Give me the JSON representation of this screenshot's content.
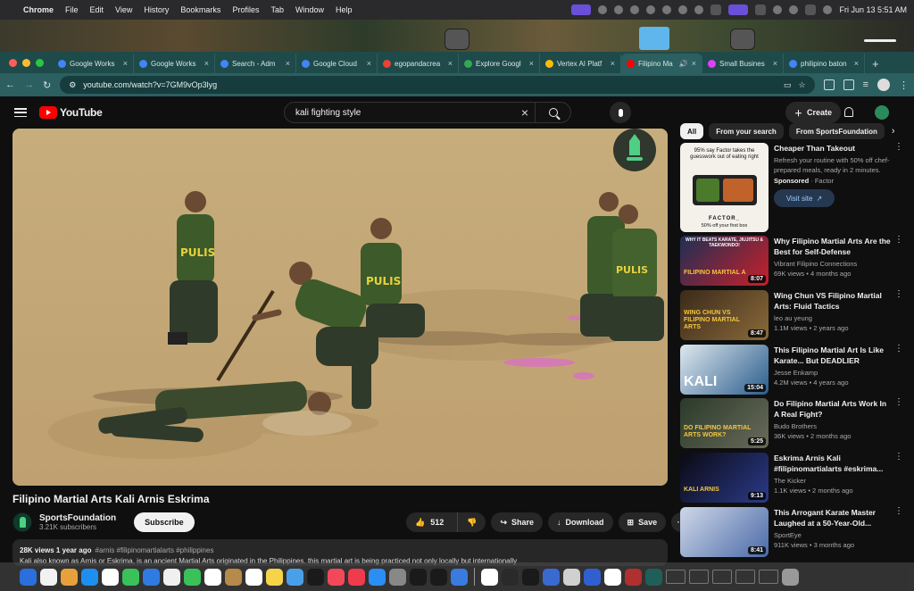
{
  "menubar": {
    "app_name": "Chrome",
    "menus": [
      "File",
      "Edit",
      "View",
      "History",
      "Bookmarks",
      "Profiles",
      "Tab",
      "Window",
      "Help"
    ],
    "datetime": "Fri Jun 13  5:51 AM"
  },
  "browser": {
    "tabs": [
      {
        "label": "Google Works",
        "color": "#4285f4"
      },
      {
        "label": "Google Works",
        "color": "#4285f4"
      },
      {
        "label": "Search - Adm",
        "color": "#4285f4"
      },
      {
        "label": "Google Cloud",
        "color": "#4285f4"
      },
      {
        "label": "egopandacrea",
        "color": "#ea4335"
      },
      {
        "label": "Explore Googl",
        "color": "#34a853"
      },
      {
        "label": "Vertex AI Platf",
        "color": "#fbbc04"
      },
      {
        "label": "Filipino Ma",
        "color": "#ff0000",
        "active": true
      },
      {
        "label": "Small Busines",
        "color": "#e040fb"
      },
      {
        "label": "philipino baton",
        "color": "#4285f4"
      }
    ],
    "url": "youtube.com/watch?v=7GM9vOp3lyg"
  },
  "youtube": {
    "logo_text": "YouTube",
    "search_query": "kali fighting style",
    "create_label": "Create"
  },
  "video": {
    "title": "Filipino Martial Arts Kali Arnis Eskrima",
    "channel": "SportsFoundation",
    "subscribers": "3.21K subscribers",
    "subscribe_label": "Subscribe",
    "likes": "512",
    "share_label": "Share",
    "download_label": "Download",
    "save_label": "Save",
    "views_date": "28K views  1 year ago",
    "hashtags": "#arnis #filipinomartialarts #philippines",
    "description": "Kali also known as Arnis or Eskrima, is an ancient Martial Arts originated in the Philippines. this martial art is being practiced not only locally but internationally",
    "shirt_text": "PULIS"
  },
  "chips": [
    "All",
    "From your search",
    "From SportsFoundation"
  ],
  "ad": {
    "title": "Cheaper Than Takeout",
    "desc": "Refresh your routine with 50% off chef-prepared meals, ready in 2 minutes.",
    "sponsored": "Sponsored",
    "advertiser": "Factor",
    "visit_label": "Visit site",
    "img_headline": "95% say Factor takes the guesswork out of eating right",
    "img_brand": "FACTOR_",
    "img_offer": "50% off your first box"
  },
  "recommendations": [
    {
      "title": "Why Filipino Martial Arts Are the Best for Self-Defense",
      "channel": "Vibrant Filipino Connections",
      "meta": "69K views • 4 months ago",
      "duration": "8:07",
      "thumb_text": "FILIPINO MARTIAL A",
      "thumb_top": "WHY IT BEATS KARATE, JIUJITSU & TAEKWONDO!",
      "colors": [
        "#1d2f55",
        "#c8202a"
      ]
    },
    {
      "title": "Wing Chun VS Filipino Martial Arts: Fluid Tactics",
      "channel": "leo au yeung",
      "meta": "1.1M views • 2 years ago",
      "duration": "8:47",
      "thumb_text": "WING CHUN VS FILIPINO MARTIAL ARTS",
      "thumb_top": "",
      "colors": [
        "#3a2a1a",
        "#8a6a3a"
      ]
    },
    {
      "title": "This Filipino Martial Art Is Like Karate... But DEADLIER",
      "channel": "Jesse Enkamp",
      "meta": "4.2M views • 4 years ago",
      "duration": "15:04",
      "thumb_text": "KALI",
      "thumb_top": "",
      "colors": [
        "#dfe8ef",
        "#2a5d8c"
      ]
    },
    {
      "title": "Do Filipino Martial Arts Work In A Real Fight?",
      "channel": "Budo Brothers",
      "meta": "36K views • 2 months ago",
      "duration": "5:25",
      "thumb_text": "DO FILIPINO MARTIAL ARTS WORK?",
      "thumb_top": "",
      "colors": [
        "#2a3a2a",
        "#6a6a5a"
      ]
    },
    {
      "title": "Eskrima Arnis Kali #filipinomartialarts #eskrima...",
      "channel": "The Kicker",
      "meta": "1.1K views • 2 months ago",
      "duration": "9:13",
      "thumb_text": "KALI ARNIS",
      "thumb_top": "",
      "colors": [
        "#0a0a12",
        "#2b3a8a"
      ]
    },
    {
      "title": "This Arrogant Karate Master Laughed at a 50-Year-Old...",
      "channel": "SportEye",
      "meta": "911K views • 3 months ago",
      "duration": "8:41",
      "thumb_text": "",
      "thumb_top": "",
      "colors": [
        "#cfd8e8",
        "#4a6aa8"
      ]
    }
  ],
  "dock": {
    "apps": [
      "#2a6fdb",
      "#f2f2f2",
      "#e8a13a",
      "#1f8ef1",
      "#ffffff",
      "#3ac15a",
      "#2f7be0",
      "#f0f0f0",
      "#3ac15a",
      "#ffffff",
      "#b58a4a",
      "#ffffff",
      "#f5d44a",
      "#4aa0e8",
      "#1a1a1a",
      "#f2485a",
      "#f03b4c",
      "#2a8ef5",
      "#888888",
      "#1a1a1a",
      "#1a1a1a",
      "#3a7be0",
      "#ffffff",
      "#2a2a2a",
      "#1a1a1a",
      "#3a6ad0",
      "#d0d0d0",
      "#3060d0",
      "#ffffff",
      "#b03030",
      "#1f5f5a"
    ]
  }
}
